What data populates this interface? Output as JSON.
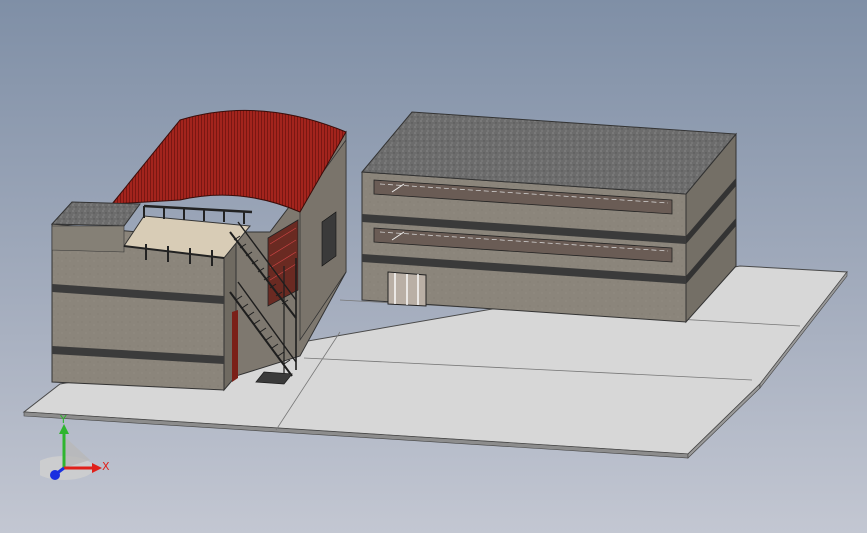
{
  "viewport": {
    "background_top": "#7f8fa6",
    "background_bottom": "#c3c7d2"
  },
  "model": {
    "ground_color": "#d6d6d6",
    "wall_color": "#8a847a",
    "roof_slab_color": "#6f6f6f",
    "curved_roof_color": "#a0231c",
    "window_frame_color": "#ffffff",
    "stair_color": "#222222"
  },
  "triad": {
    "x_label": "X",
    "y_label": "Y",
    "x_color": "#e0201a",
    "y_color": "#2fb52f",
    "z_color": "#1a2fe0"
  }
}
